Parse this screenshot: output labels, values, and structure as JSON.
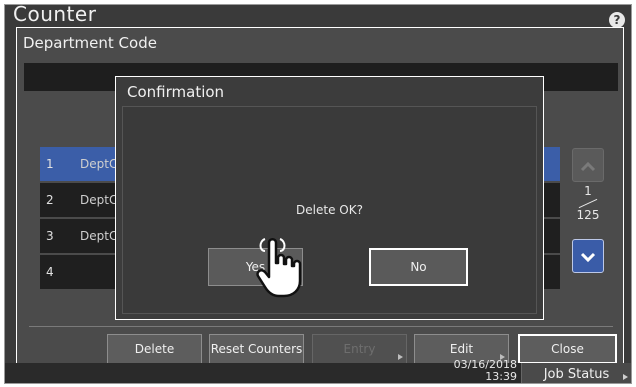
{
  "app": {
    "title": "Counter",
    "help_label": "?"
  },
  "panel": {
    "title": "Department Code",
    "rows": [
      {
        "num": "1",
        "name": "DeptC"
      },
      {
        "num": "2",
        "name": "DeptC"
      },
      {
        "num": "3",
        "name": "DeptC"
      },
      {
        "num": "4",
        "name": ""
      }
    ],
    "pager": {
      "current": "1",
      "total": "125"
    },
    "buttons": {
      "delete": "Delete",
      "reset": "Reset Counters",
      "entry": "Entry",
      "edit": "Edit",
      "close": "Close"
    }
  },
  "dialog": {
    "title": "Confirmation",
    "message": "Delete OK?",
    "yes": "Yes",
    "no": "No"
  },
  "status": {
    "date": "03/16/2018",
    "time": "13:39",
    "job_status": "Job Status"
  },
  "colors": {
    "selected_row": "#3b5ea8",
    "background": "#3a3a3a"
  }
}
